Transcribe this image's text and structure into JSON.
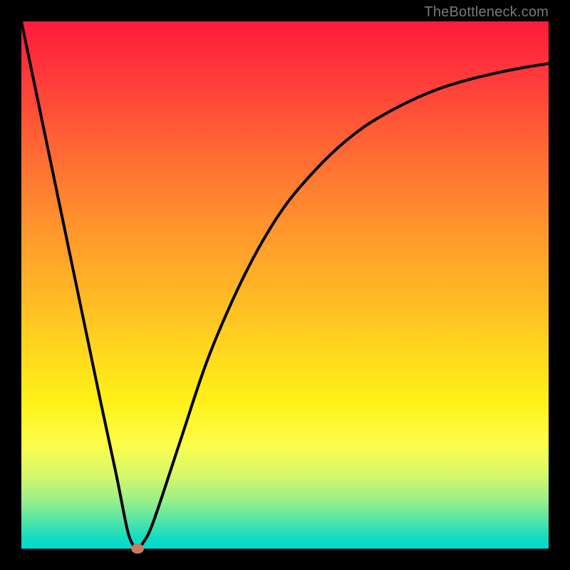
{
  "watermark": "TheBottleneck.com",
  "colors": {
    "frame": "#000000",
    "gradient_top": "#ff1a3c",
    "gradient_bottom": "#00d9d1",
    "curve": "#000000",
    "marker": "#c77a66",
    "watermark": "#7a7a7a"
  },
  "chart_data": {
    "type": "line",
    "title": "",
    "xlabel": "",
    "ylabel": "",
    "xlim": [
      0,
      100
    ],
    "ylim": [
      0,
      100
    ],
    "x": [
      0,
      5,
      10,
      15,
      18,
      20,
      21,
      22,
      23,
      25,
      30,
      35,
      40,
      45,
      50,
      55,
      60,
      65,
      70,
      75,
      80,
      85,
      90,
      95,
      100
    ],
    "values": [
      100,
      76,
      52,
      28,
      14,
      4,
      1,
      0,
      1,
      5,
      20,
      35,
      47,
      57,
      65,
      71,
      76,
      80,
      83,
      85.5,
      87.5,
      89,
      90.2,
      91.2,
      92
    ],
    "marker": {
      "x": 22,
      "y": 0
    },
    "grid": false,
    "legend": false,
    "background": "rainbow-vertical-gradient"
  }
}
